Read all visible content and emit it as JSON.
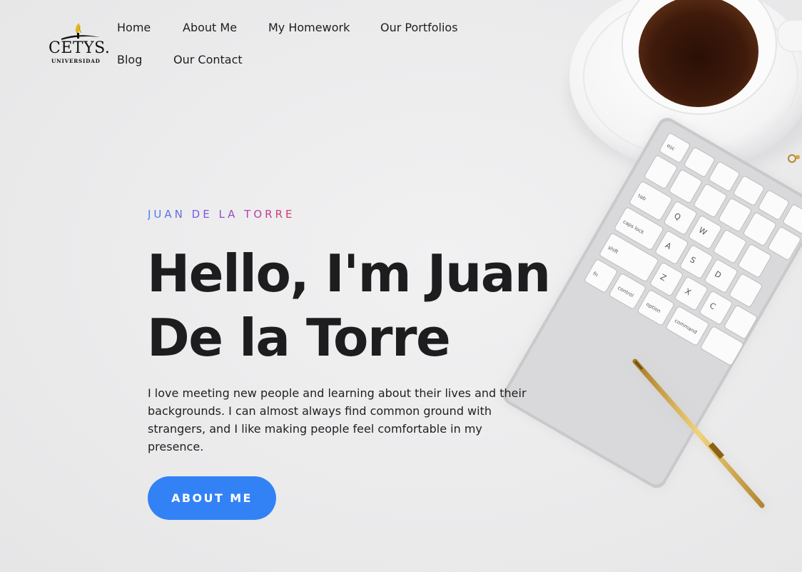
{
  "brand": {
    "wordmark": "CETYS.",
    "subtitle": "UNIVERSIDAD"
  },
  "nav": {
    "items": [
      {
        "label": "Home"
      },
      {
        "label": "About Me"
      },
      {
        "label": "My Homework"
      },
      {
        "label": "Our Portfolios"
      },
      {
        "label": "Blog"
      },
      {
        "label": "Our Contact"
      }
    ]
  },
  "hero": {
    "eyebrow": "JUAN DE LA TORRE",
    "title_line1": "Hello, I'm Juan",
    "title_line2": "De la Torre",
    "intro": "I love meeting new people and learning about their lives and their backgrounds. I can almost always find common ground with strangers, and I like making people feel comfortable in my presence.",
    "button_label": "ABOUT ME"
  },
  "colors": {
    "accent": "#3282f6",
    "eyebrow_gradient": [
      "#3f7ff0",
      "#8a4fd8",
      "#e0346a"
    ],
    "title": "#1d1d1f",
    "background": "#ececed"
  },
  "keyboard_keys": [
    "esc",
    "tab",
    "caps lock",
    "shift",
    "fn",
    "control",
    "option",
    "command",
    "Q",
    "W",
    "A",
    "S",
    "D",
    "Z",
    "X",
    "C"
  ]
}
